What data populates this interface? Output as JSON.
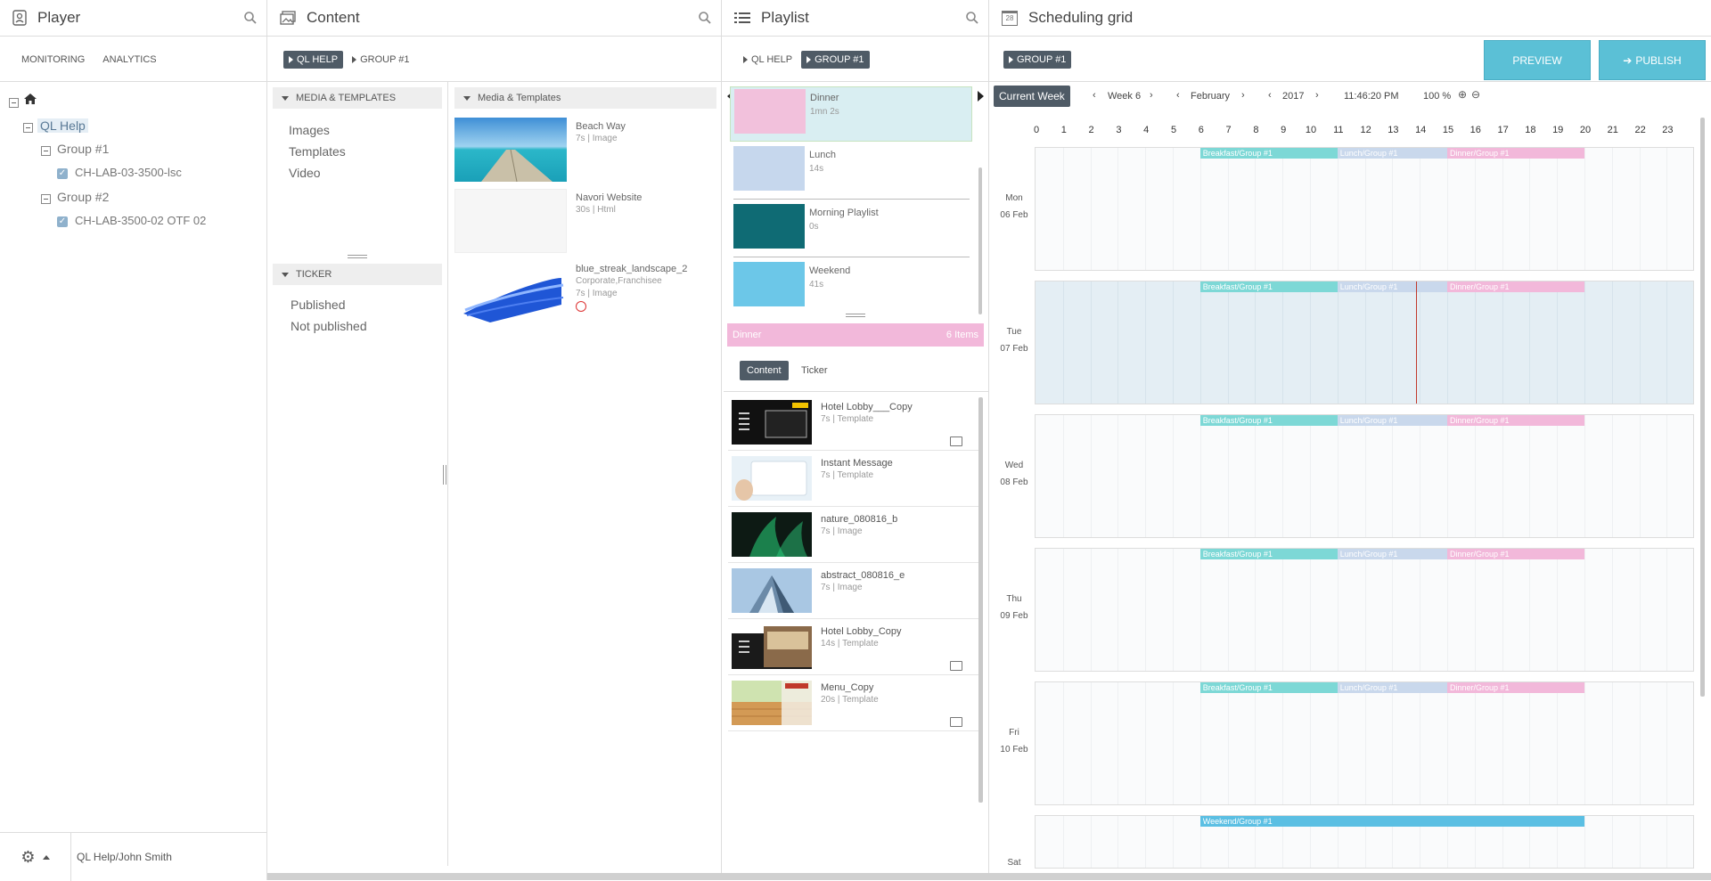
{
  "colors": {
    "dark_chip": "#4f5b66",
    "accent": "#5bc0d6",
    "breakfast": "#7dd8d6",
    "lunch": "#c9d8ec",
    "dinner": "#f2b8da",
    "weekend": "#5bbfe3",
    "teal": "#0f6b74",
    "now_line": "#c0392b"
  },
  "player": {
    "title": "Player",
    "icon": "player-icon",
    "tabs": [
      "MONITORING",
      "ANALYTICS"
    ],
    "tree": {
      "root": "QL Help",
      "groups": [
        {
          "label": "Group #1",
          "device": "CH-LAB-03-3500-lsc"
        },
        {
          "label": "Group #2",
          "device": "CH-LAB-3500-02 OTF 02"
        }
      ]
    },
    "footer_user": "QL Help/John Smith"
  },
  "content": {
    "title": "Content",
    "crumbs": [
      "QL HELP",
      "GROUP #1"
    ],
    "sec_media": "MEDIA & TEMPLATES",
    "media_links": [
      "Images",
      "Templates",
      "Video"
    ],
    "sec_ticker": "TICKER",
    "ticker_links": [
      "Published",
      "Not published"
    ],
    "list_header": "Media & Templates",
    "items": [
      {
        "name": "Beach Way",
        "meta": "7s | Image"
      },
      {
        "name": "Navori Website",
        "meta": "30s | Html"
      },
      {
        "name": "blue_streak_landscape_2",
        "meta": "Corporate,Franchisee",
        "meta2": "7s | Image"
      }
    ]
  },
  "playlist": {
    "title": "Playlist",
    "crumbs": [
      "QL HELP",
      "GROUP #1"
    ],
    "lists": [
      {
        "name": "Dinner",
        "dur": "1mn 2s"
      },
      {
        "name": "Lunch",
        "dur": "14s"
      },
      {
        "name": "Morning Playlist",
        "dur": "0s"
      },
      {
        "name": "Weekend",
        "dur": "41s"
      }
    ],
    "selected": {
      "name": "Dinner",
      "count": "6 Items"
    },
    "tabs": [
      "Content",
      "Ticker"
    ],
    "items": [
      {
        "name": "Hotel Lobby___Copy",
        "meta": "7s | Template"
      },
      {
        "name": "Instant Message",
        "meta": "7s | Template"
      },
      {
        "name": "nature_080816_b",
        "meta": "7s | Image"
      },
      {
        "name": "abstract_080816_e",
        "meta": "7s | Image"
      },
      {
        "name": "Hotel Lobby_Copy",
        "meta": "14s | Template"
      },
      {
        "name": "Menu_Copy",
        "meta": "20s | Template"
      }
    ]
  },
  "schedule": {
    "title": "Scheduling grid",
    "icon_text": "28",
    "crumb": "GROUP #1",
    "preview": "PREVIEW",
    "publish": "PUBLISH",
    "current_week": "Current Week",
    "week": "Week 6",
    "month": "February",
    "year": "2017",
    "time": "11:46:20 PM",
    "zoom": "100 %",
    "hours": [
      "0",
      "1",
      "2",
      "3",
      "4",
      "5",
      "6",
      "7",
      "8",
      "9",
      "10",
      "11",
      "12",
      "13",
      "14",
      "15",
      "16",
      "17",
      "18",
      "19",
      "20",
      "21",
      "22",
      "23"
    ],
    "days": [
      {
        "d": "Mon",
        "date": "06 Feb"
      },
      {
        "d": "Tue",
        "date": "07 Feb"
      },
      {
        "d": "Wed",
        "date": "08 Feb"
      },
      {
        "d": "Thu",
        "date": "09 Feb"
      },
      {
        "d": "Fri",
        "date": "10 Feb"
      },
      {
        "d": "Sat",
        "date": ""
      }
    ],
    "bars": {
      "breakfast": "Breakfast/Group #1",
      "lunch": "Lunch/Group #1",
      "dinner": "Dinner/Group #1",
      "weekend": "Weekend/Group #1"
    }
  }
}
